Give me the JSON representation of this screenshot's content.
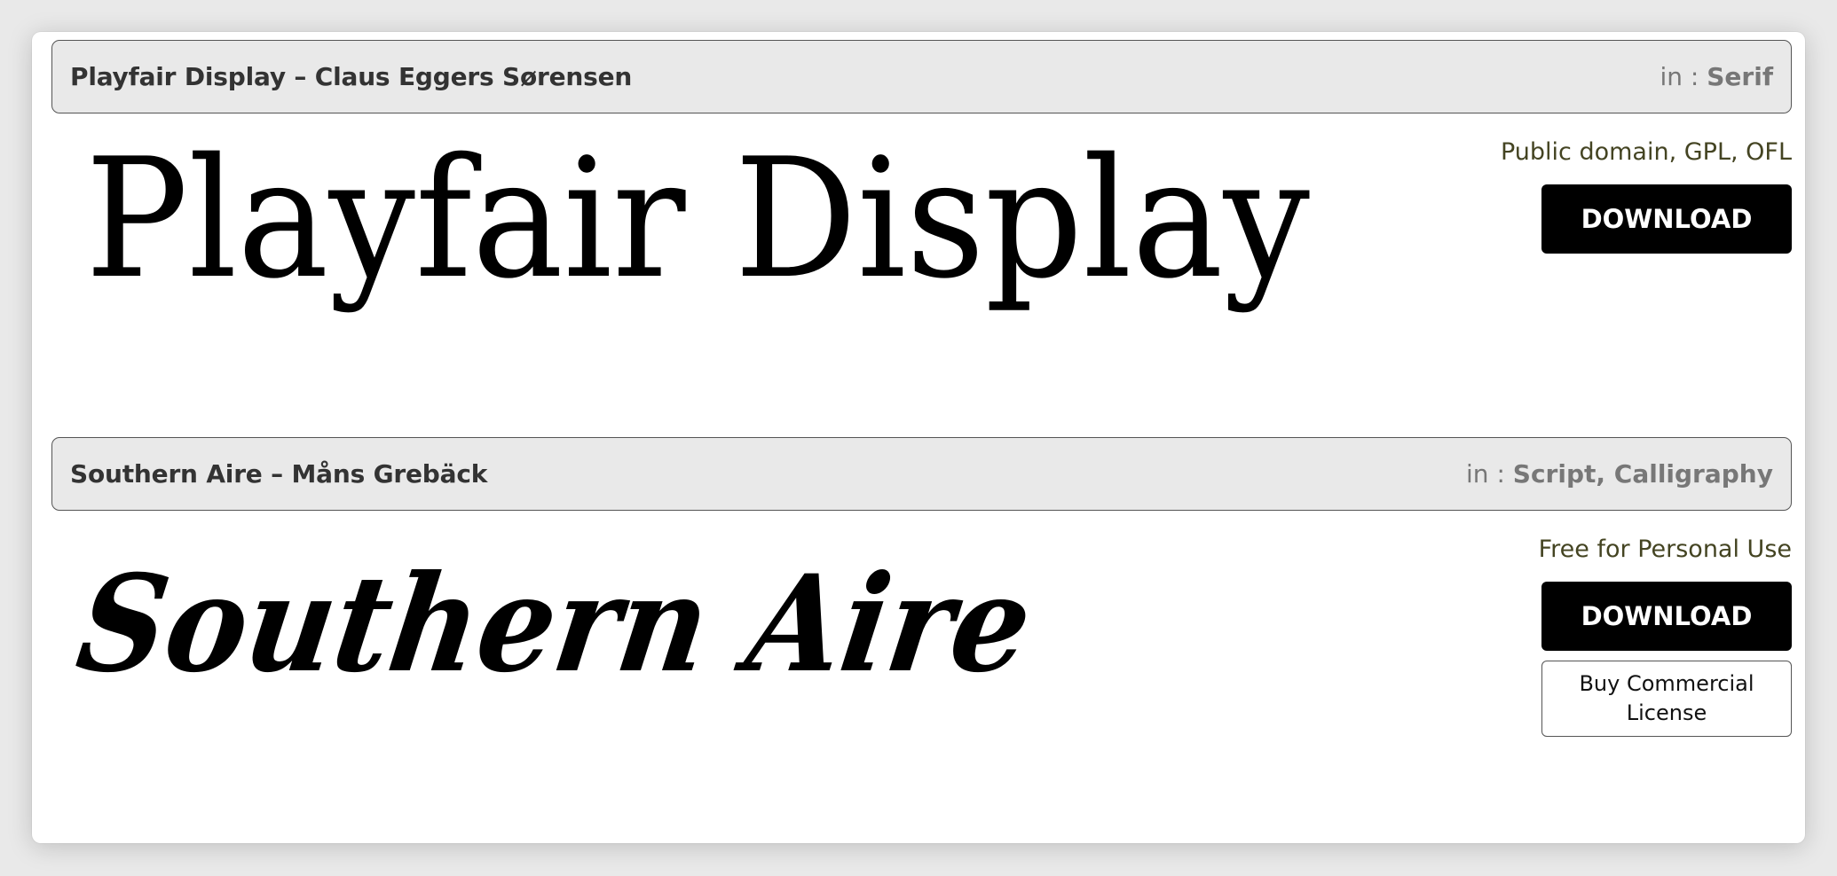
{
  "fonts": [
    {
      "title": "Playfair Display – Claus Eggers Sørensen",
      "in_label": "in : ",
      "categories": "Serif",
      "preview_text": "Playfair Display",
      "license": "Public domain, GPL, OFL",
      "download_label": "DOWNLOAD"
    },
    {
      "title": "Southern Aire – Måns Grebäck",
      "in_label": "in : ",
      "categories": "Script, Calligraphy",
      "preview_text": "Southern Aire",
      "license": "Free for Personal Use",
      "download_label": "DOWNLOAD",
      "commercial_label": "Buy Commercial License"
    }
  ]
}
